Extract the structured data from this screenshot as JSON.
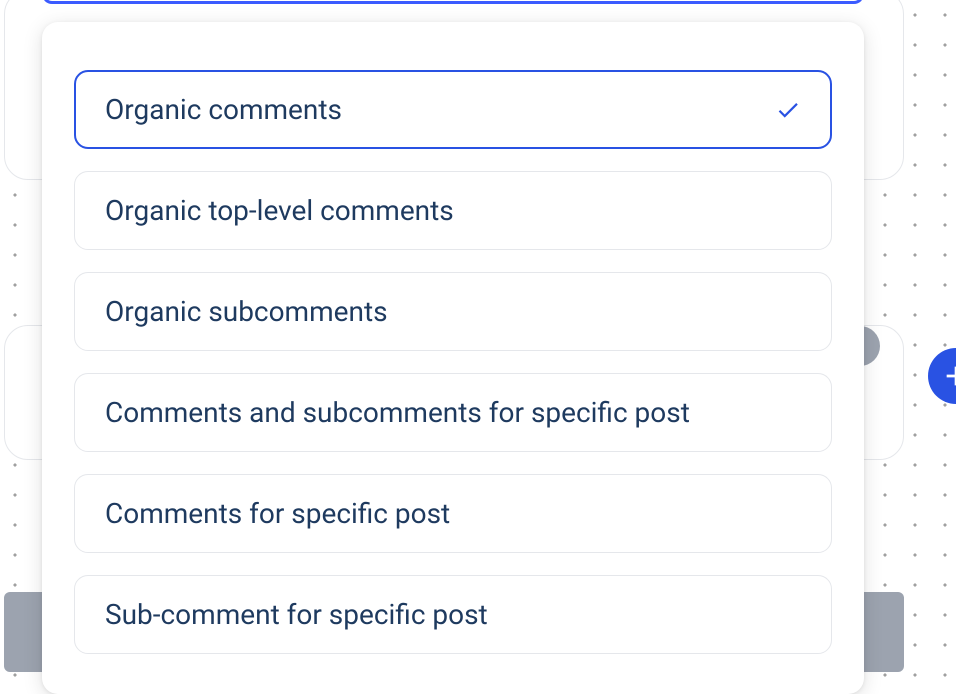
{
  "dropdown": {
    "options": [
      {
        "label": "Organic comments",
        "selected": true
      },
      {
        "label": "Organic top-level comments",
        "selected": false
      },
      {
        "label": "Organic subcomments",
        "selected": false
      },
      {
        "label": "Comments and subcomments for specific post",
        "selected": false
      },
      {
        "label": "Comments for specific post",
        "selected": false
      },
      {
        "label": "Sub-comment for specific post",
        "selected": false
      }
    ]
  }
}
